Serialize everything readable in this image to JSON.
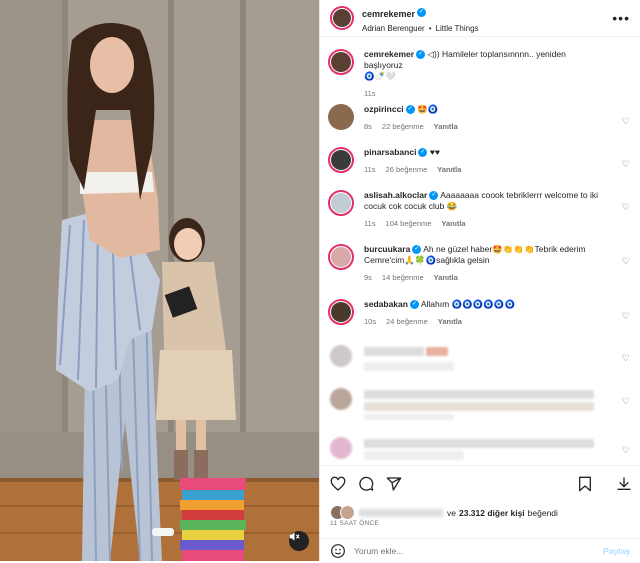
{
  "header": {
    "username": "cemrekemer",
    "audio_artist": "Adrian Berenguer",
    "audio_track": "Little Things",
    "separator": "•",
    "more": "•••"
  },
  "caption": {
    "username": "cemrekemer",
    "text": "◁)) Hamileler toplansınnnn.. yeniden başlıyoruz",
    "emojis": "🧿🍼🤍",
    "time": "11s"
  },
  "comments": [
    {
      "user": "ozpirincci",
      "text": "🤩🧿",
      "time": "8s",
      "likes": "22 beğenme",
      "reply": "Yanıtla",
      "avatar_color": "#8a6a4c"
    },
    {
      "user": "pinarsabanci",
      "text": "♥♥",
      "time": "11s",
      "likes": "26 beğenme",
      "reply": "Yanıtla",
      "avatar_color": "#3a3a3a"
    },
    {
      "user": "aslisah.alkoclar",
      "text": "Aaaaaaaa coook tebriklerrr welcome to iki cocuk cok cocuk club 😂",
      "time": "11s",
      "likes": "104 beğenme",
      "reply": "Yanıtla",
      "avatar_color": "#c2ccd4"
    },
    {
      "user": "burcuukara",
      "text": "Ah ne güzel haber🤩👏👏👏Tebrik ederim Cemre'cim🙏🍀🧿sağlıkla gelsin",
      "time": "9s",
      "likes": "14 beğenme",
      "reply": "Yanıtla",
      "avatar_color": "#d7a9a9"
    },
    {
      "user": "sedabakan",
      "text": "Allahım 🧿🧿🧿🧿🧿🧿",
      "time": "10s",
      "likes": "24 beğenme",
      "reply": "Yanıtla",
      "avatar_color": "#4a3a2c"
    }
  ],
  "likes": {
    "prefix": "ve",
    "count": "23.312 diğer kişi",
    "suffix": "beğendi"
  },
  "time_ago": "11 SAAT ÖNCE",
  "add_comment": {
    "placeholder": "Yorum ekle...",
    "post": "Paylaş"
  },
  "colors": {
    "verified": "#0095f6",
    "story_ring": "#e1306c",
    "meta_text": "#737373"
  },
  "icons": [
    "verified-icon",
    "heart-icon",
    "comment-icon",
    "share-icon",
    "bookmark-icon",
    "download-icon",
    "emoji-icon",
    "mute-icon",
    "more-icon"
  ]
}
